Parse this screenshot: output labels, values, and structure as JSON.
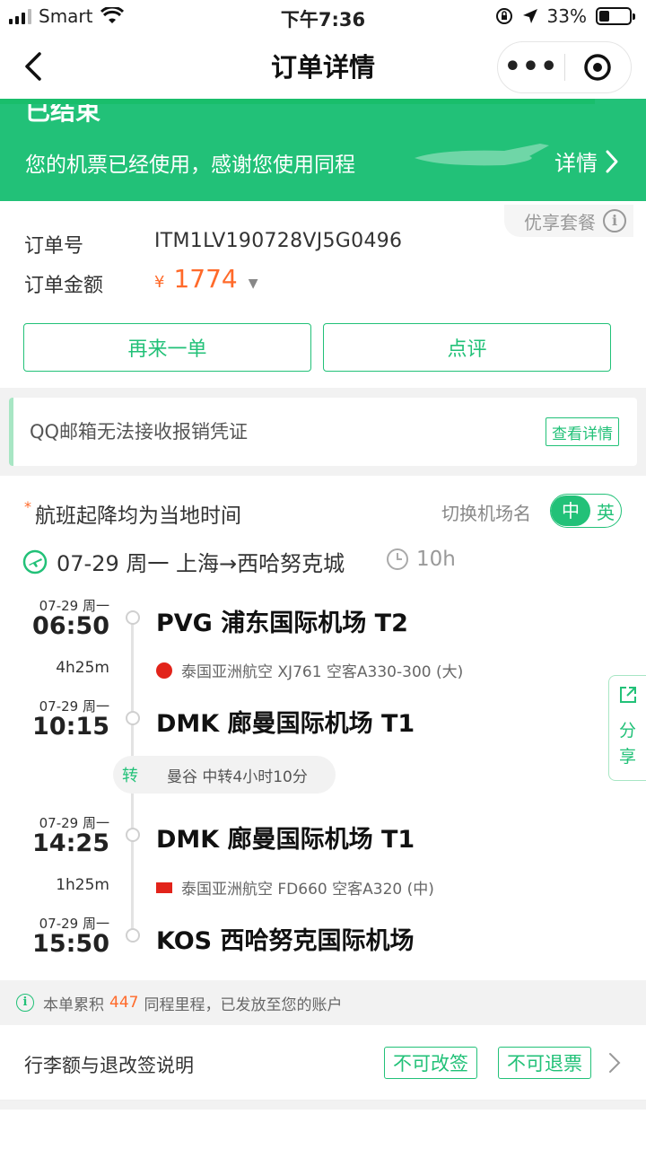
{
  "status_bar": {
    "carrier": "Smart",
    "time": "下午7:36",
    "battery": "33%"
  },
  "nav": {
    "title": "订单详情",
    "more": "•••"
  },
  "banner": {
    "status": "已结束",
    "message": "您的机票已经使用，感谢您使用同程",
    "detail_label": "详情"
  },
  "order": {
    "perk_label": "优享套餐",
    "number_label": "订单号",
    "number_value": "ITM1LV190728VJ5G0496",
    "amount_label": "订单金额",
    "currency": "¥",
    "amount": "1774",
    "reorder_label": "再来一单",
    "review_label": "点评"
  },
  "notice": {
    "text": "QQ邮箱无法接收报销凭证",
    "button": "查看详情"
  },
  "flight": {
    "note_star": "*",
    "note": "航班起降均为当地时间",
    "switch_label": "切换机场名",
    "lang_on": "中",
    "lang_off": "英",
    "trip": "07-29 周一 上海→西哈努克城",
    "total_duration": "10h",
    "stops": [
      {
        "date": "07-29 周一",
        "time": "06:50",
        "airport": "PVG 浦东国际机场 T2"
      },
      {
        "date": "07-29 周一",
        "time": "10:15",
        "airport": "DMK 廊曼国际机场 T1"
      },
      {
        "date": "07-29 周一",
        "time": "14:25",
        "airport": "DMK 廊曼国际机场 T1"
      },
      {
        "date": "07-29 周一",
        "time": "15:50",
        "airport": "KOS 西哈努克国际机场"
      }
    ],
    "segments": [
      {
        "duration": "4h25m",
        "info": "泰国亚洲航空 XJ761 空客A330-300 (大)"
      },
      {
        "duration": "1h25m",
        "info": "泰国亚洲航空 FD660 空客A320 (中)"
      }
    ],
    "transfer_tag": "转",
    "transfer_text": "曼谷 中转4小时10分"
  },
  "share": {
    "label_1": "分",
    "label_2": "享"
  },
  "mileage": {
    "prefix": "本单累积",
    "points": "447",
    "suffix": "同程里程，已发放至您的账户"
  },
  "baggage": {
    "label": "行李额与退改签说明",
    "tag_change": "不可改签",
    "tag_refund": "不可退票"
  },
  "colors": {
    "brand_green": "#22c178",
    "price_orange": "#ff6a2a"
  }
}
